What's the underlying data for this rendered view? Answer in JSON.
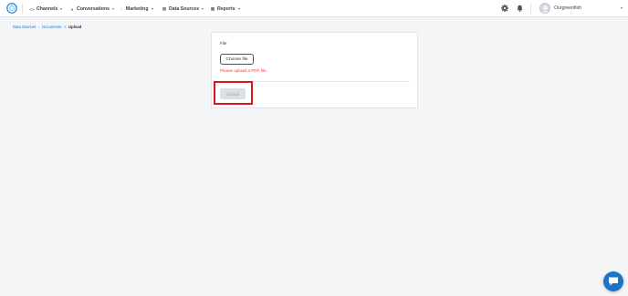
{
  "header": {
    "nav": [
      {
        "label": "Channels",
        "icon": "channels-icon"
      },
      {
        "label": "Conversations",
        "icon": "chat-bubbles-icon"
      },
      {
        "label": "Marketing",
        "icon": "megaphone-icon"
      },
      {
        "label": "Data Sources",
        "icon": "database-icon"
      },
      {
        "label": "Reports",
        "icon": "bar-chart-icon"
      }
    ],
    "user_name": "Ourgreenfish"
  },
  "breadcrumb": {
    "items": [
      "Data Sources",
      "Documents"
    ],
    "separator": "-",
    "separator_last": ">",
    "current": "Upload"
  },
  "form": {
    "file_label": "File",
    "choose_button": "Choose file",
    "error_message": "Please upload a PDF file.",
    "upload_button": "Upload",
    "upload_disabled": true
  },
  "colors": {
    "accent": "#1e73c8",
    "error": "#e0473c",
    "highlight": "#e0121b"
  }
}
